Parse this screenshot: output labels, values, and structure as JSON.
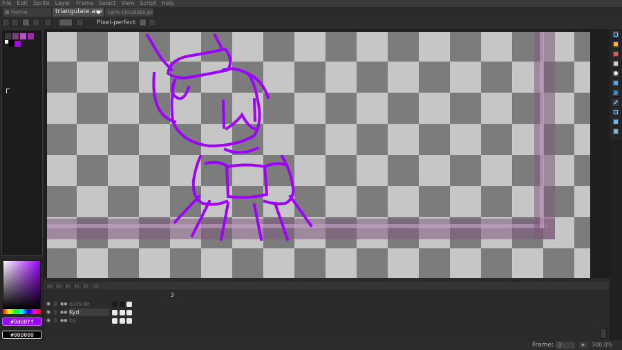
{
  "menu": [
    "File",
    "Edit",
    "Sprite",
    "Layer",
    "Frame",
    "Select",
    "View",
    "Script",
    "Help"
  ],
  "tabs": [
    {
      "label": "Home",
      "active": false
    },
    {
      "label": "triangulate.ase",
      "active": true
    },
    {
      "label": "cam-circulate.png",
      "active": false
    }
  ],
  "context_bar": {
    "pixel_perfect_label": "Pixel-perfect"
  },
  "palette": {
    "swatches": [
      "#3a3a3a",
      "#7a3e7c",
      "#c04ccc",
      "#9a2ea6",
      "#ffffff",
      "#000000",
      "#9d00ff"
    ]
  },
  "colors": {
    "foreground": "#9d00ff",
    "background": "#000000",
    "accent": "#9d00ff"
  },
  "layers": [
    {
      "name": "outside",
      "visible": true,
      "selected": false,
      "cel": "filled"
    },
    {
      "name": "Kyd",
      "visible": true,
      "selected": true,
      "cel": "filled"
    },
    {
      "name": "bu",
      "visible": true,
      "selected": false,
      "cel": "filled"
    }
  ],
  "timeline": {
    "frame_header": "3"
  },
  "status": {
    "frame_label": "Frame:",
    "frame_value": "3",
    "zoom": "300.0%"
  },
  "icons": {
    "menu_icon": "window-icon",
    "tools": [
      "marquee-icon",
      "pencil-icon",
      "eraser-icon",
      "eyedropper-icon",
      "zoom-icon",
      "fill-icon",
      "line-icon",
      "rectangle-icon",
      "contour-icon",
      "blur-icon",
      "text-icon"
    ]
  }
}
